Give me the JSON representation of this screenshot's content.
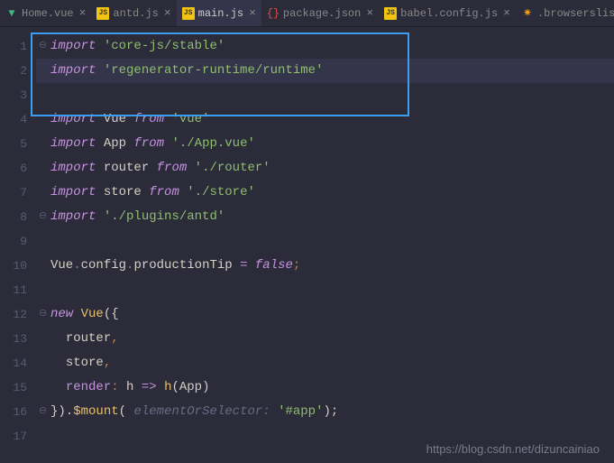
{
  "tabs": [
    {
      "label": "Home.vue",
      "icon": "vue"
    },
    {
      "label": "antd.js",
      "icon": "js"
    },
    {
      "label": "main.js",
      "icon": "js",
      "active": true
    },
    {
      "label": "package.json",
      "icon": "json"
    },
    {
      "label": "babel.config.js",
      "icon": "js"
    },
    {
      "label": ".browserslistrc",
      "icon": "browserslist"
    }
  ],
  "line_numbers": [
    "1",
    "2",
    "3",
    "4",
    "5",
    "6",
    "7",
    "8",
    "9",
    "10",
    "11",
    "12",
    "13",
    "14",
    "15",
    "16",
    "17"
  ],
  "code": {
    "l1": {
      "kw": "import",
      "str": "'core-js/stable'"
    },
    "l2": {
      "kw": "import",
      "str": "'regenerator-runtime/runtime'"
    },
    "l4": {
      "kw": "import",
      "id": "Vue",
      "from": "from",
      "str": "'vue'"
    },
    "l5": {
      "kw": "import",
      "id": "App",
      "from": "from",
      "str": "'./App.vue'"
    },
    "l6": {
      "kw": "import",
      "id": "router",
      "from": "from",
      "str": "'./router'"
    },
    "l7": {
      "kw": "import",
      "id": "store",
      "from": "from",
      "str": "'./store'"
    },
    "l8": {
      "kw": "import",
      "str": "'./plugins/antd'"
    },
    "l10": {
      "obj": "Vue",
      "dot1": ".",
      "p1": "config",
      "dot2": ".",
      "p2": "productionTip",
      "op": " = ",
      "val": "false",
      "semi": ";"
    },
    "l12": {
      "kw": "new",
      "cls": "Vue",
      "open": "({"
    },
    "l13": {
      "prop": "router",
      "comma": ","
    },
    "l14": {
      "prop": "store",
      "comma": ","
    },
    "l15": {
      "prop": "render",
      "colon": ": ",
      "arg": "h",
      "arrow": " => ",
      "fn": "h",
      "op1": "(",
      "app": "App",
      "op2": ")"
    },
    "l16": {
      "close": "}).",
      "fn": "$mount",
      "op1": "(",
      "hint": " elementOrSelector: ",
      "str": "'#app'",
      "op2": ");"
    }
  },
  "watermark": "https://blog.csdn.net/dizuncainiao"
}
